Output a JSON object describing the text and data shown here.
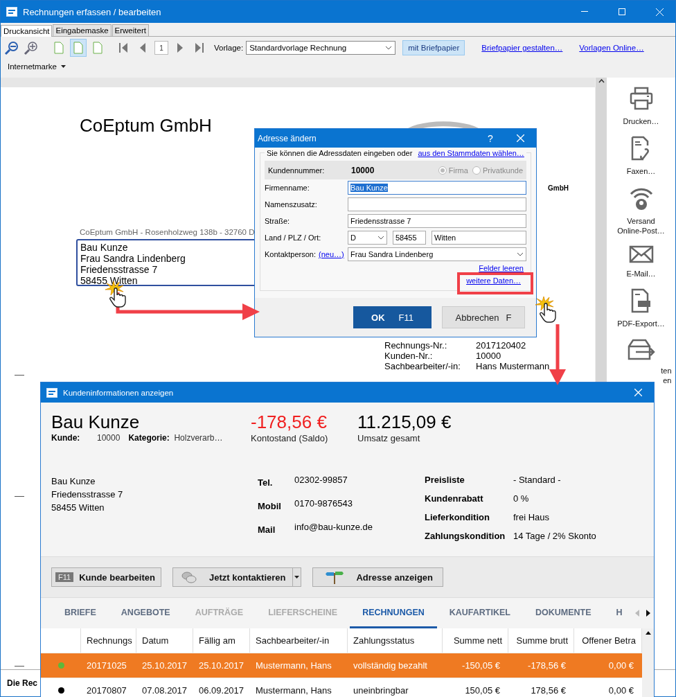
{
  "window": {
    "title": "Rechnungen erfassen / bearbeiten"
  },
  "tabs": [
    {
      "label": "Druckansicht",
      "selected": true
    },
    {
      "label": "Eingabemaske",
      "selected": false
    },
    {
      "label": "Erweitert",
      "selected": false
    }
  ],
  "toolbar": {
    "view_buttons": [
      {
        "selected": false
      },
      {
        "selected": true
      },
      {
        "selected": false
      }
    ],
    "page": "1",
    "template_label": "Vorlage:",
    "template": "Standardvorlage Rechnung",
    "letterhead": {
      "label": "mit Briefpapier",
      "on": true
    },
    "links": [
      "Briefpapier gestalten…",
      "Vorlagen Online…"
    ],
    "menu": "Internetmarke"
  },
  "document": {
    "company": "CoEptum GmbH",
    "logo_text": "GmbH",
    "sender_line": "CoEptum GmbH - Rosenholzweg 138b - 32760 D",
    "address": [
      "Bau Kunze",
      "Frau Sandra Lindenberg",
      "Friedensstrasse 7",
      "58455 Witten"
    ],
    "info": [
      {
        "label": "Rechnungs-Nr.:",
        "value": "2017120402"
      },
      {
        "label": "Kunden-Nr.:",
        "value": "10000"
      },
      {
        "label": "Sachbearbeiter/-in:",
        "value": "Hans Mustermann"
      }
    ]
  },
  "sidebar": [
    {
      "kind": "printer",
      "label": [
        "Drucken…"
      ]
    },
    {
      "kind": "fax",
      "label": [
        "Faxen…"
      ]
    },
    {
      "kind": "post",
      "label": [
        "Versand",
        "Online-Post…"
      ]
    },
    {
      "kind": "mail",
      "label": [
        "E-Mail…"
      ]
    },
    {
      "kind": "pdf",
      "label": [
        "PDF-Export…"
      ]
    },
    {
      "kind": "box",
      "label": [
        "ten",
        "en"
      ]
    }
  ],
  "status": "Die Rec",
  "address_dialog": {
    "title": "Adresse ändern",
    "help": "?",
    "intro": "Sie können die Adressdaten eingeben oder",
    "intro_link": "aus den Stammdaten wählen…",
    "customer_number_label": "Kundennummer:",
    "customer_number": "10000",
    "types": [
      {
        "label": "Firma",
        "selected": true
      },
      {
        "label": "Privatkunde",
        "selected": false
      }
    ],
    "fields": [
      {
        "kind": "text",
        "label": "Firmenname:",
        "value": "Bau Kunze",
        "focused": true
      },
      {
        "kind": "text",
        "label": "Namenszusatz:",
        "focused": false
      },
      {
        "kind": "text",
        "label": "Straße:",
        "value": "Friedensstrasse 7",
        "focused": false
      },
      {
        "kind": "place",
        "label": "Land / PLZ / Ort:",
        "country": "D",
        "zip": "58455",
        "city": "Witten"
      },
      {
        "kind": "contact",
        "label": "Kontaktperson:",
        "link": "(neu…)",
        "value": "Frau Sandra Lindenberg"
      }
    ],
    "clear_link": "Felder leeren",
    "more_link": "weitere Daten…",
    "ok": {
      "label": "OK",
      "key": "F11"
    },
    "cancel": {
      "label": "Abbrechen",
      "key": "F"
    }
  },
  "customer_window": {
    "title": "Kundeninformationen anzeigen",
    "name": "Bau Kunze",
    "meta": [
      {
        "label": "Kunde:",
        "value": "10000"
      },
      {
        "label": "Kategorie:",
        "value": "Holzverarb…"
      }
    ],
    "figures": [
      {
        "value": "-178,56 €",
        "caption": "Kontostand (Saldo)",
        "negative": true
      },
      {
        "value": "11.215,09 €",
        "caption": "Umsatz gesamt",
        "negative": false
      }
    ],
    "address": [
      "Bau Kunze",
      "Friedensstrasse 7",
      "58455 Witten"
    ],
    "contact": [
      {
        "label": "Tel.",
        "value": "02302-99857"
      },
      {
        "label": "Mobil",
        "value": "0170-9876543"
      },
      {
        "label": "Mail",
        "value": "info@bau-kunze.de"
      }
    ],
    "terms": [
      {
        "label": "Preisliste",
        "value": "- Standard -"
      },
      {
        "label": "Kundenrabatt",
        "value": "0 %"
      },
      {
        "label": "Lieferkondition",
        "value": "frei Haus"
      },
      {
        "label": "Zahlungskondition",
        "value": "14 Tage / 2% Skonto"
      }
    ],
    "buttons": [
      {
        "kind": "edit",
        "key": "F11",
        "label": "Kunde bearbeiten"
      },
      {
        "kind": "contact",
        "label": "Jetzt kontaktieren"
      },
      {
        "kind": "map",
        "label": "Adresse anzeigen"
      }
    ],
    "tabs": [
      {
        "label": "BRIEFE",
        "selected": false,
        "disabled": false
      },
      {
        "label": "ANGEBOTE",
        "selected": false,
        "disabled": false
      },
      {
        "label": "AUFTRÄGE",
        "selected": false,
        "disabled": true
      },
      {
        "label": "LIEFERSCHEINE",
        "selected": false,
        "disabled": true
      },
      {
        "label": "RECHNUNGEN",
        "selected": true,
        "disabled": false
      },
      {
        "label": "KAUFARTIKEL",
        "selected": false,
        "disabled": false
      },
      {
        "label": "DOKUMENTE",
        "selected": false,
        "disabled": false
      },
      {
        "label": "H",
        "selected": false,
        "disabled": false
      }
    ],
    "table": {
      "columns": [
        {
          "label": "Rechnungs",
          "kind": "text"
        },
        {
          "label": "Datum",
          "kind": "text"
        },
        {
          "label": "Fällig am",
          "kind": "text"
        },
        {
          "label": "Sachbearbeiter/-in",
          "kind": "text"
        },
        {
          "label": "Zahlungsstatus",
          "kind": "text"
        },
        {
          "label": "Summe nett",
          "kind": "amount"
        },
        {
          "label": "Summe brutt",
          "kind": "amount"
        },
        {
          "label": "Offener Betra",
          "kind": "amount"
        }
      ],
      "rows": [
        {
          "color": "#5db83a",
          "selected": true,
          "cells": [
            "20171025",
            "25.10.2017",
            "25.10.2017",
            "Mustermann, Hans",
            "vollständig bezahlt",
            "-150,05 €",
            "-178,56 €",
            "0,00 €"
          ]
        },
        {
          "color": "#000000",
          "selected": false,
          "cells": [
            "20170807",
            "07.08.2017",
            "06.09.2017",
            "Mustermann, Hans",
            "uneinbringbar",
            "150,05 €",
            "178,56 €",
            "0,00 €"
          ]
        }
      ]
    }
  }
}
